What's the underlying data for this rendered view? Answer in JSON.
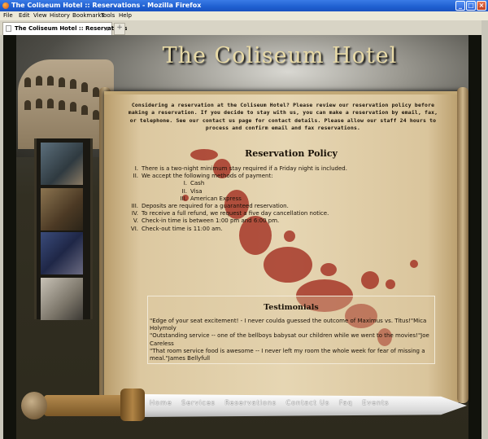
{
  "window": {
    "title": "The Coliseum Hotel :: Reservations - Mozilla Firefox",
    "controls": {
      "minimize": "_",
      "maximize": "□",
      "close": "×"
    }
  },
  "menu": [
    "File",
    "Edit",
    "View",
    "History",
    "Bookmarks",
    "Tools",
    "Help"
  ],
  "tabs": [
    {
      "label": "The Coliseum Hotel :: Reservations",
      "close": "×"
    }
  ],
  "new_tab_label": "+",
  "site": {
    "title": "The Coliseum Hotel"
  },
  "intro": "Considering a reservation at the Coliseum Hotel? Please review our reservation policy before making a reservation. If you decide to stay with us, you can make a reservation by email, fax, or telephone. See our contact us page for contact details. Please allow our staff 24 hours to process and confirm email and fax reservations.",
  "policy": {
    "title": "Reservation Policy",
    "items": [
      {
        "num": "I.",
        "text": "There is a two-night minimum stay required if a Friday night is included."
      },
      {
        "num": "II.",
        "text": "We accept the following methods of payment:"
      },
      {
        "num": "III.",
        "text": "Deposits are required for a guaranteed reservation."
      },
      {
        "num": "IV.",
        "text": "To receive a full refund, we request a five day cancellation notice."
      },
      {
        "num": "V.",
        "text": "Check-in time is between 1:00 pm and 6:00 pm."
      },
      {
        "num": "VI.",
        "text": "Check-out time is 11:00 am."
      }
    ],
    "payments": [
      {
        "num": "I.",
        "text": "Cash"
      },
      {
        "num": "II.",
        "text": "Visa"
      },
      {
        "num": "III.",
        "text": "American Express"
      }
    ]
  },
  "testimonials": {
    "title": "Testimonials",
    "quotes": [
      "\"Edge of your seat excitement! - I never coulda guessed the outcome of Maximus vs. Titus!\"Mica Holymoly",
      "\"Outstanding service -- one of the bellboys babysat our children while we went to the movies!\"Joe Careless",
      "\"That room service food is awesome -- I never left my room the whole week for fear of missing a meal.\"James Bellyfull"
    ]
  },
  "nav": [
    "Home",
    "Services",
    "Reservations",
    "Contact Us",
    "Faq",
    "Events"
  ]
}
